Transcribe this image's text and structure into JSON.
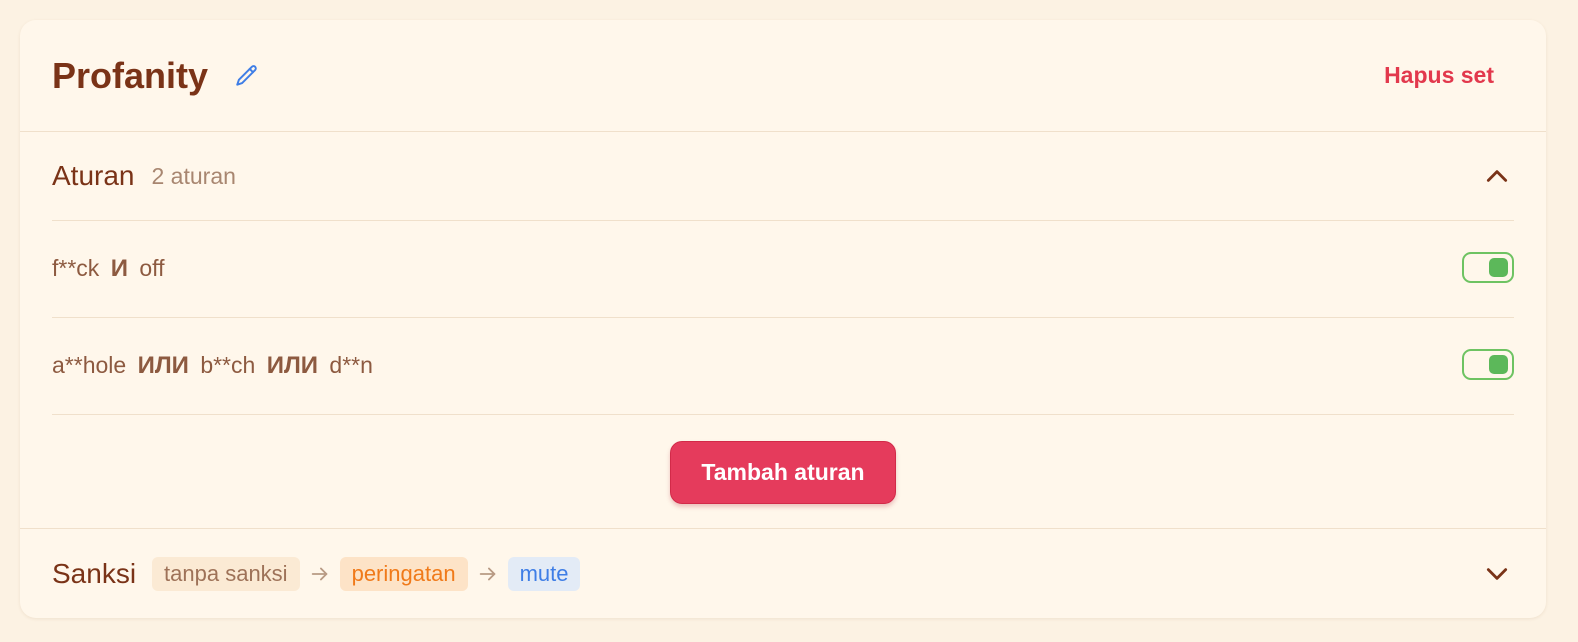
{
  "header": {
    "title": "Profanity",
    "delete_label": "Hapus set"
  },
  "rules_section": {
    "label": "Aturan",
    "count": "2 aturan",
    "expanded": true,
    "rules": [
      {
        "parts": [
          "f**ck",
          "И",
          "off"
        ],
        "enabled": true
      },
      {
        "parts": [
          "a**hole",
          "ИЛИ",
          "b**ch",
          "ИЛИ",
          "d**n"
        ],
        "enabled": true
      }
    ],
    "add_label": "Tambah aturan"
  },
  "sanctions_section": {
    "label": "Sanksi",
    "steps": [
      "tanpa sanksi",
      "peringatan",
      "mute"
    ],
    "expanded": false
  },
  "colors": {
    "background": "#fcf2e3",
    "card": "#fff7eb",
    "title": "#7a3317",
    "danger": "#e2384c",
    "add_button": "#e53b5c",
    "toggle_on": "#5cb85a",
    "warning": "#f07a1a",
    "mute": "#3f7ee6",
    "edit_icon": "#3f7ee6"
  },
  "icons": {
    "edit": "pencil-icon",
    "collapse": "chevron-up-icon",
    "expand": "chevron-down-icon",
    "step_separator": "arrow-right-icon"
  }
}
